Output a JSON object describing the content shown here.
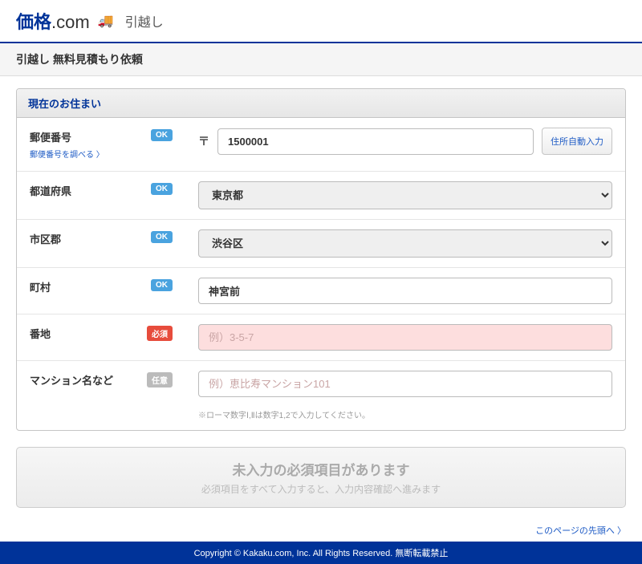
{
  "header": {
    "logo_blue": "価格",
    "logo_com": ".com",
    "service_name": "引越し"
  },
  "page_title": "引越し 無料見積もり依頼",
  "panel": {
    "title": "現在のお住まい"
  },
  "fields": {
    "postal": {
      "label": "郵便番号",
      "sub_link": "郵便番号を調べる 〉",
      "badge": "OK",
      "value": "1500001",
      "mark": "〒",
      "auto_btn": "住所自動入力"
    },
    "prefecture": {
      "label": "都道府県",
      "badge": "OK",
      "value": "東京都"
    },
    "city": {
      "label": "市区郡",
      "badge": "OK",
      "value": "渋谷区"
    },
    "town": {
      "label": "町村",
      "badge": "OK",
      "value": "神宮前"
    },
    "street": {
      "label": "番地",
      "badge": "必須",
      "placeholder": "例）3-5-7",
      "value": ""
    },
    "building": {
      "label": "マンション名など",
      "badge": "任意",
      "placeholder": "例）恵比寿マンション101",
      "value": "",
      "note": "※ローマ数字Ⅰ,Ⅱは数字1,2で入力してください。"
    }
  },
  "submit": {
    "main": "未入力の必須項目があります",
    "sub": "必須項目をすべて入力すると、入力内容確認へ進みます"
  },
  "top_link": "このページの先頭へ 〉",
  "footer": "Copyright © Kakaku.com, Inc. All Rights Reserved. 無断転載禁止"
}
